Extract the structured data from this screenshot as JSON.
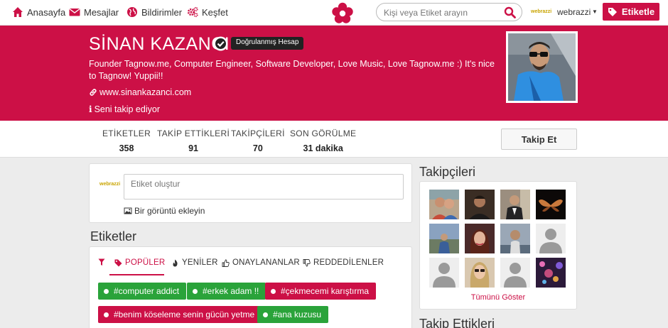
{
  "nav": {
    "home": "Anasayfa",
    "messages": "Mesajlar",
    "notifications": "Bildirimler",
    "explore": "Keşfet",
    "search_placeholder": "Kişi veya Etiket arayın",
    "user_logo": "webrazzi",
    "user_name": "webrazzi",
    "tag_button": "Etiketle"
  },
  "profile": {
    "name": "SİNAN KAZANCI",
    "verified_label": "Doğrulanmış Hesap",
    "bio": "Founder Tagnow.me, Computer Engineer, Software Developer, Love Music, Love Tagnow.me :) It's nice to Tagnow! Yuppii!!",
    "website": "www.sinankazanci.com",
    "follows_you": "Seni takip ediyor"
  },
  "stats": [
    {
      "label": "ETİKETLER",
      "value": "358"
    },
    {
      "label": "TAKİP ETTİKLERİ",
      "value": "91"
    },
    {
      "label": "TAKİPÇİLERİ",
      "value": "70"
    },
    {
      "label": "SON GÖRÜLME",
      "value": "31 dakika"
    }
  ],
  "follow_button": "Takip Et",
  "composer": {
    "logo": "webrazzi",
    "placeholder": "Etiket oluştur",
    "add_image": "Bir görüntü ekleyin"
  },
  "tags_section": {
    "title": "Etiketler",
    "tabs": [
      "POPÜLER",
      "YENİLER",
      "ONAYLANANLAR",
      "REDDEDİLENLER"
    ],
    "active_tab": "POPÜLER",
    "pills": [
      {
        "label": "#computer addict",
        "color": "#2aa33a"
      },
      {
        "label": "#erkek adam !!",
        "color": "#2aa33a"
      },
      {
        "label": "#çekmecemi karıştırma",
        "color": "#cc1046"
      },
      {
        "label": "#benim köseleme senin gücün yetme",
        "color": "#cc1046"
      },
      {
        "label": "#ana kuzusu",
        "color": "#2aa33a"
      }
    ]
  },
  "followers_section": {
    "title": "Takipçileri",
    "show_all": "Tümünü Göster"
  },
  "following_section": {
    "title": "Takip Ettikleri"
  },
  "colors": {
    "brand": "#cc1046",
    "green": "#2aa33a"
  }
}
